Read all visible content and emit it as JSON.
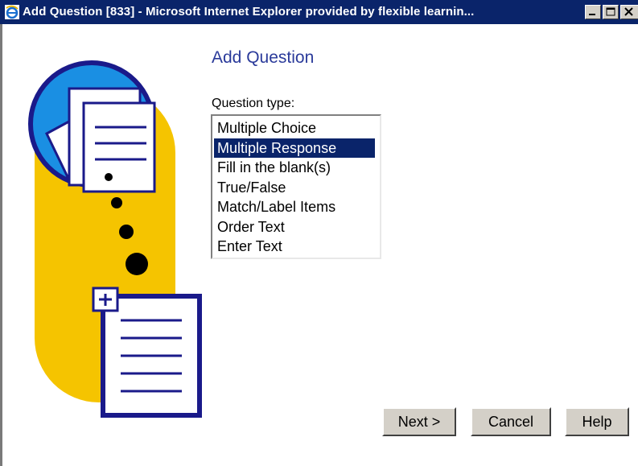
{
  "window": {
    "title": "Add Question [833] - Microsoft Internet Explorer provided by flexible learnin...",
    "title_bar_color": "#0a246a"
  },
  "page": {
    "heading": "Add Question",
    "question_type_label": "Question type:",
    "question_types": [
      "Multiple Choice",
      "Multiple Response",
      "Fill in the blank(s)",
      "True/False",
      "Match/Label Items",
      "Order Text",
      "Enter Text"
    ],
    "selected_index": 1
  },
  "buttons": {
    "next": "Next >",
    "cancel": "Cancel",
    "help": "Help"
  },
  "colors": {
    "heading": "#2a3a9a",
    "selection": "#0a246a",
    "illustration_yellow": "#f5c400",
    "illustration_blue": "#1a8fe3",
    "illustration_navy": "#1a1a8a"
  },
  "icons": [
    "ie-window-icon",
    "minimize-icon",
    "maximize-icon",
    "close-icon",
    "add-question-illustration"
  ]
}
